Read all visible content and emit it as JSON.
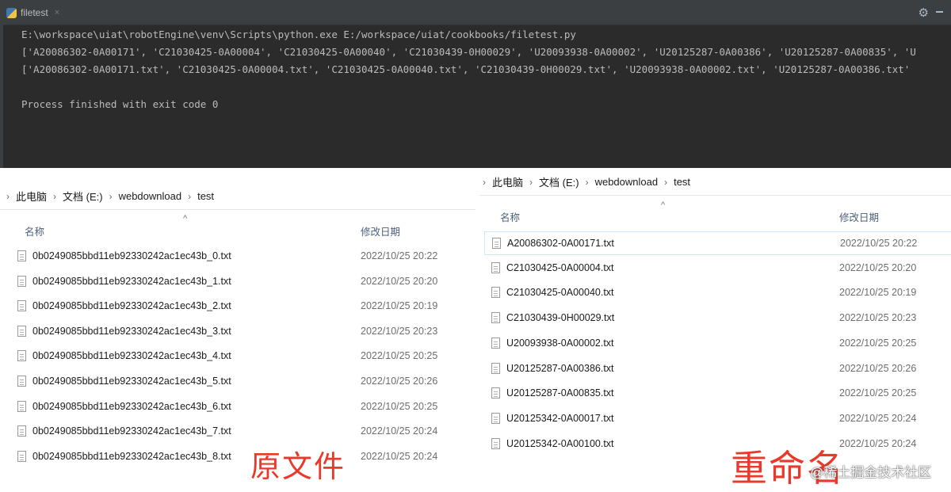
{
  "terminal": {
    "tab_title": "filetest",
    "tab_close": "×",
    "gear": "⚙",
    "lines": [
      "E:\\workspace\\uiat\\robotEngine\\venv\\Scripts\\python.exe E:/workspace/uiat/cookbooks/filetest.py",
      "['A20086302-0A00171', 'C21030425-0A00004', 'C21030425-0A00040', 'C21030439-0H00029', 'U20093938-0A00002', 'U20125287-0A00386', 'U20125287-0A00835', 'U",
      "['A20086302-0A00171.txt', 'C21030425-0A00004.txt', 'C21030425-0A00040.txt', 'C21030439-0H00029.txt', 'U20093938-0A00002.txt', 'U20125287-0A00386.txt'"
    ],
    "exit_line": "Process finished with exit code 0"
  },
  "left_explorer": {
    "breadcrumb": [
      "此电脑",
      "文档 (E:)",
      "webdownload",
      "test"
    ],
    "col_name": "名称",
    "col_date": "修改日期",
    "files": [
      {
        "name": "0b0249085bbd11eb92330242ac1ec43b_0.txt",
        "date": "2022/10/25 20:22"
      },
      {
        "name": "0b0249085bbd11eb92330242ac1ec43b_1.txt",
        "date": "2022/10/25 20:20"
      },
      {
        "name": "0b0249085bbd11eb92330242ac1ec43b_2.txt",
        "date": "2022/10/25 20:19"
      },
      {
        "name": "0b0249085bbd11eb92330242ac1ec43b_3.txt",
        "date": "2022/10/25 20:23"
      },
      {
        "name": "0b0249085bbd11eb92330242ac1ec43b_4.txt",
        "date": "2022/10/25 20:25"
      },
      {
        "name": "0b0249085bbd11eb92330242ac1ec43b_5.txt",
        "date": "2022/10/25 20:26"
      },
      {
        "name": "0b0249085bbd11eb92330242ac1ec43b_6.txt",
        "date": "2022/10/25 20:25"
      },
      {
        "name": "0b0249085bbd11eb92330242ac1ec43b_7.txt",
        "date": "2022/10/25 20:24"
      },
      {
        "name": "0b0249085bbd11eb92330242ac1ec43b_8.txt",
        "date": "2022/10/25 20:24"
      }
    ],
    "overlay_label": "原文件"
  },
  "right_explorer": {
    "breadcrumb": [
      "此电脑",
      "文档 (E:)",
      "webdownload",
      "test"
    ],
    "col_name": "名称",
    "col_date": "修改日期",
    "files": [
      {
        "name": "A20086302-0A00171.txt",
        "date": "2022/10/25 20:22"
      },
      {
        "name": "C21030425-0A00004.txt",
        "date": "2022/10/25 20:20"
      },
      {
        "name": "C21030425-0A00040.txt",
        "date": "2022/10/25 20:19"
      },
      {
        "name": "C21030439-0H00029.txt",
        "date": "2022/10/25 20:23"
      },
      {
        "name": "U20093938-0A00002.txt",
        "date": "2022/10/25 20:25"
      },
      {
        "name": "U20125287-0A00386.txt",
        "date": "2022/10/25 20:26"
      },
      {
        "name": "U20125287-0A00835.txt",
        "date": "2022/10/25 20:25"
      },
      {
        "name": "U20125342-0A00017.txt",
        "date": "2022/10/25 20:24"
      },
      {
        "name": "U20125342-0A00100.txt",
        "date": "2022/10/25 20:24"
      }
    ],
    "overlay_label": "重命名"
  },
  "watermark": "@稀土掘金技术社区",
  "colors": {
    "terminal_bg": "#2b2b2b",
    "annotation_red": "#e8392b",
    "selection": "#cce8ff"
  }
}
